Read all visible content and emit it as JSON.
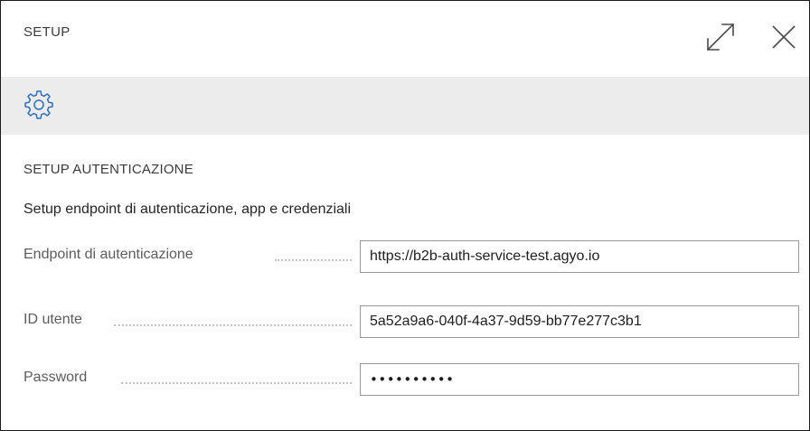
{
  "dialog": {
    "title": "SETUP",
    "icons": {
      "expand": "expand-icon",
      "close": "close-icon",
      "settings": "gear-icon"
    },
    "accent_color": "#2f6fbd"
  },
  "section": {
    "title": "SETUP AUTENTICAZIONE",
    "instructions": "Setup endpoint di autenticazione, app e credenziali"
  },
  "fields": {
    "endpoint": {
      "label": "Endpoint di autenticazione",
      "value": "https://b2b-auth-service-test.agyo.io"
    },
    "user_id": {
      "label": "ID utente",
      "value": "5a52a9a6-040f-4a37-9d59-bb77e277c3b1"
    },
    "password": {
      "label": "Password",
      "value": "••••••••••"
    }
  }
}
